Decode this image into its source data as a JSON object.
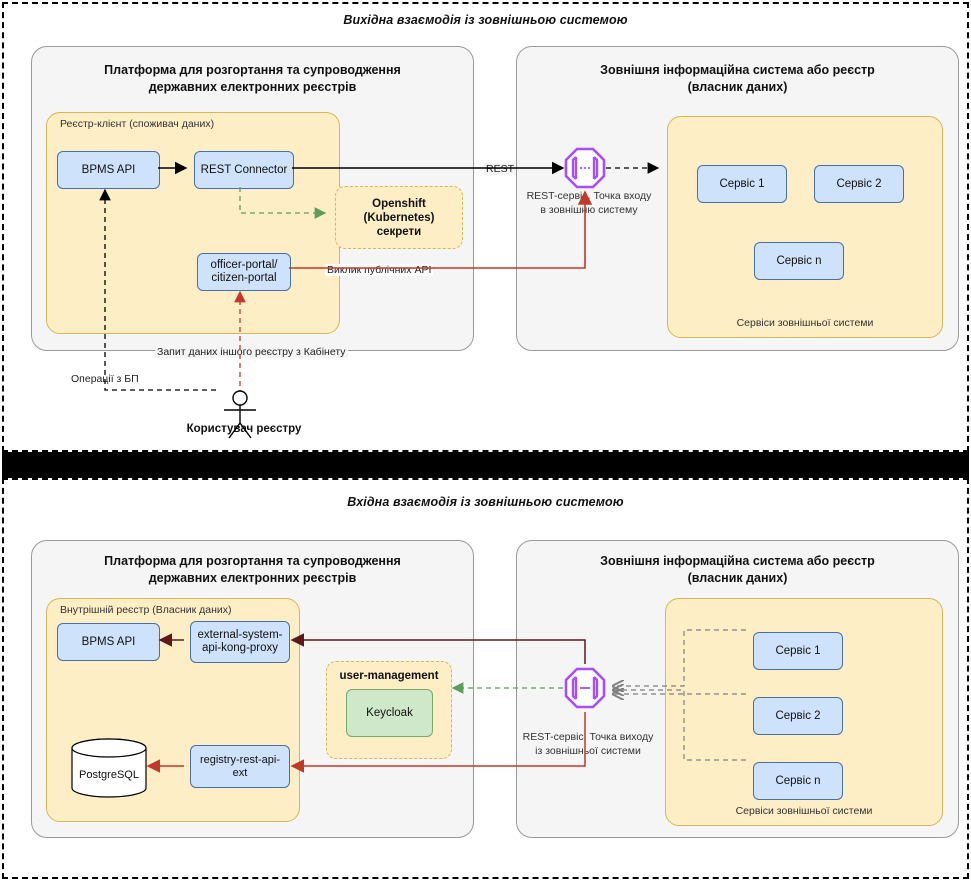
{
  "diagram": {
    "top_panel": {
      "title": "Вихідна взаємодія із зовнішньою системою",
      "platform": {
        "title_line1": "Платформа для розгортання та супроводження",
        "title_line2": "державних електронних реєстрів",
        "registry_label": "Реєстр-клієнт (споживач даних)",
        "nodes": {
          "bpms_api": "BPMS API",
          "rest_connector": "REST Connector",
          "portal_line1": "officer-portal/",
          "portal_line2": "citizen-portal"
        },
        "secrets_line1": "Openshift (Kubernetes)",
        "secrets_line2": "секрети"
      },
      "external": {
        "title_line1": "Зовнішня інформаційна система або реєстр",
        "title_line2": "(власник даних)",
        "services_caption": "Сервіси зовнішньої системи",
        "services": [
          "Сервіс 1",
          "Сервіс 2",
          "Сервіс n"
        ]
      },
      "edges": {
        "rest": "REST",
        "gateway_line1": "REST-сервіс. Точка входу",
        "gateway_line2": "в зовнішню систему",
        "public_api_call": "Виклик публічних API",
        "kabinet_request": "Запит даних іншого реєстру з Кабінету",
        "bp_operations": "Операції з БП"
      },
      "actor": "Користувач реєстру"
    },
    "bottom_panel": {
      "title": "Вхідна взаємодія із зовнішньою системою",
      "platform": {
        "title_line1": "Платформа для розгортання та супроводження",
        "title_line2": "державних електронних реєстрів",
        "registry_label": "Внутрішній реєстр (Власник даних)",
        "nodes": {
          "bpms_api": "BPMS API",
          "kong_proxy_line1": "external-system-",
          "kong_proxy_line2": "api-kong-proxy",
          "registry_rest_api_ext": "registry-rest-api-ext",
          "keycloak": "Keycloak",
          "postgresql": "PostgreSQL"
        },
        "user_management": "user-management"
      },
      "external": {
        "title_line1": "Зовнішня інформаційна система або реєстр",
        "title_line2": "(власник даних)",
        "services_caption": "Сервіси зовнішньої системи",
        "services": [
          "Сервіс 1",
          "Сервіс 2",
          "Сервіс n"
        ]
      },
      "edges": {
        "gateway_line1": "REST-сервіс. Точка виходу",
        "gateway_line2": "із зовнішньої системи"
      }
    },
    "colors": {
      "node_fill": "#cfe2fb",
      "node_stroke": "#4a6fa5",
      "group_fill": "#f5f5f5",
      "subgroup_fill": "#fdeec5",
      "subgroup_stroke": "#d6b656",
      "gateway_stroke": "#a64dff",
      "red_edge": "#c0392b",
      "dark_red_edge": "#5d1a1a",
      "green_edge": "#5d9d5d",
      "black_edge": "#000000",
      "gray_edge": "#808080"
    },
    "icons": {
      "gateway": "api-gateway-icon",
      "actor": "user-actor-icon",
      "database": "database-cylinder-icon"
    }
  }
}
